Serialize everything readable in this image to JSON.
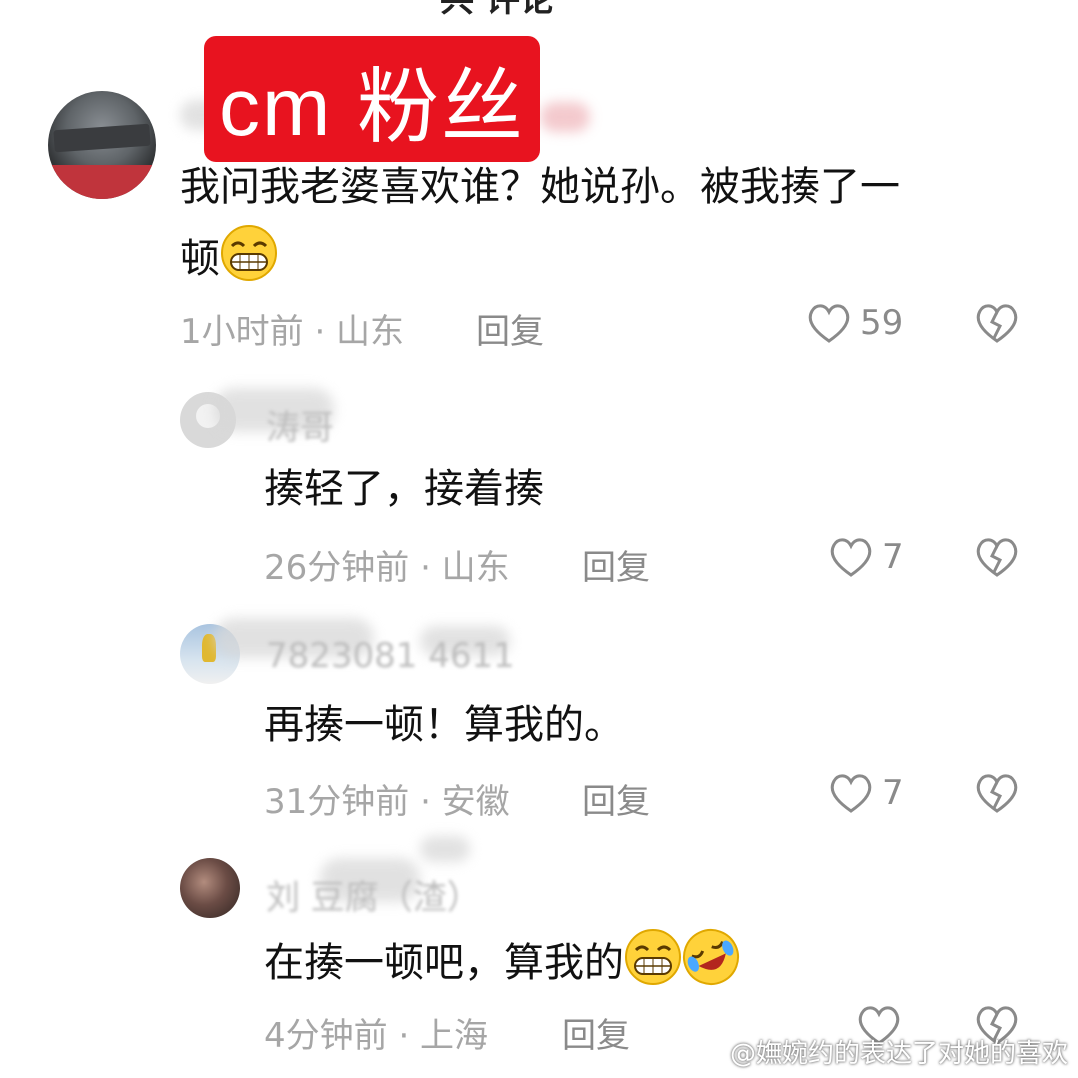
{
  "header": {
    "cut_title": "共 评论"
  },
  "badge": {
    "label": "cm 粉丝"
  },
  "comments": [
    {
      "text_line1": "我问我老婆喜欢谁？她说孙。被我揍了一",
      "text_line2": "顿",
      "emoji": "grin",
      "meta": "1小时前 · 山东",
      "reply": "回复",
      "likes": "59"
    },
    {
      "name": "涛哥",
      "text": "揍轻了，接着揍",
      "meta": "26分钟前 · 山东",
      "reply": "回复",
      "likes": "7"
    },
    {
      "name": "7823081 4611",
      "text": "再揍一顿！算我的。",
      "meta": "31分钟前 · 安徽",
      "reply": "回复",
      "likes": "7"
    },
    {
      "name": "刘 豆腐（渣）",
      "text": "在揍一顿吧，算我的",
      "emojis": [
        "grin",
        "rolling-laugh"
      ],
      "meta": "4分钟前 · 上海",
      "reply": "回复",
      "likes": ""
    }
  ],
  "watermark": {
    "text": "@嫵婉约的表达了对她的喜欢"
  },
  "icons": {
    "like": "heart-outline-icon",
    "dislike": "broken-heart-icon",
    "weibo": "weibo-logo-icon"
  }
}
